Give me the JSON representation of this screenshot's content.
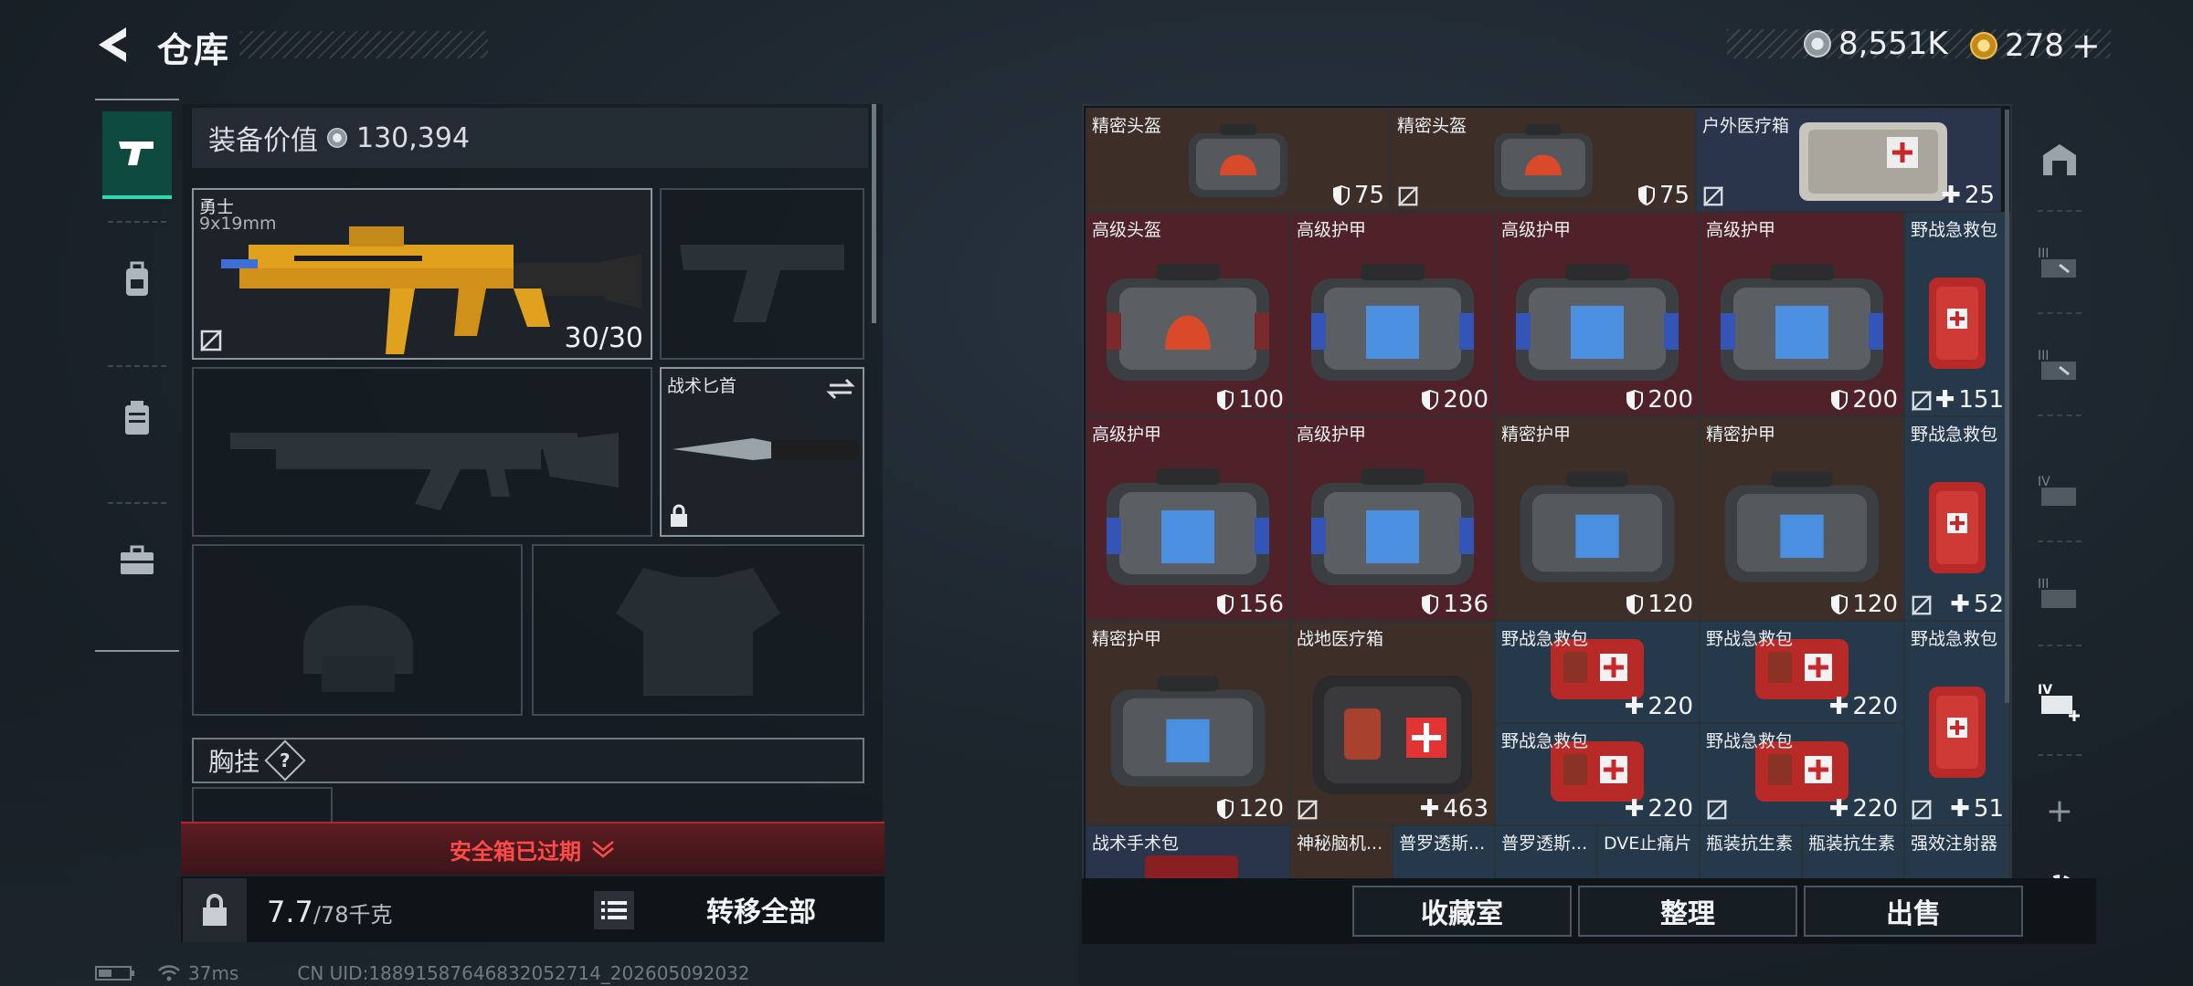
{
  "header": {
    "title": "仓库",
    "currency1": "8,551K",
    "currency2": "278"
  },
  "equipment": {
    "value_label": "装备价值",
    "value": "130,394",
    "primary": {
      "name": "勇士",
      "caliber": "9x19mm",
      "ammo": "30/30"
    },
    "melee": {
      "name": "战术匕首"
    },
    "chest_rig_label": "胸挂",
    "chest_rig_hint": "?",
    "expired_label": "安全箱已过期",
    "weight": "7.7",
    "weight_max": "/78千克",
    "move_all": "转移全部"
  },
  "storage": {
    "row1": [
      {
        "label": "精密头盔",
        "value": "75",
        "kind": "shield"
      },
      {
        "label": "精密头盔",
        "value": "75",
        "kind": "shield"
      },
      {
        "label": "户外医疗箱",
        "value": "25",
        "kind": "plus"
      }
    ],
    "row2": [
      {
        "label": "高级头盔",
        "value": "100"
      },
      {
        "label": "高级护甲",
        "value": "200"
      },
      {
        "label": "高级护甲",
        "value": "200"
      },
      {
        "label": "高级护甲",
        "value": "200"
      },
      {
        "label": "野战急救包",
        "value": "151"
      }
    ],
    "row3": [
      {
        "label": "高级护甲",
        "value": "156"
      },
      {
        "label": "高级护甲",
        "value": "136"
      },
      {
        "label": "精密护甲",
        "value": "120"
      },
      {
        "label": "精密护甲",
        "value": "120"
      },
      {
        "label": "野战急救包",
        "value": "52"
      }
    ],
    "row4": {
      "armor": {
        "label": "精密护甲",
        "value": "120"
      },
      "medbox": {
        "label": "战地医疗箱",
        "value": "463"
      },
      "kits": [
        {
          "label": "野战急救包",
          "value": "220"
        },
        {
          "label": "野战急救包",
          "value": "220"
        },
        {
          "label": "野战急救包",
          "value": "220"
        },
        {
          "label": "野战急救包",
          "value": "220"
        }
      ],
      "kit_tall": {
        "label": "野战急救包",
        "value": "51"
      }
    },
    "row5": [
      "战术手术包",
      "神秘脑机...",
      "普罗透斯...",
      "普罗透斯...",
      "DVE止痛片",
      "瓶装抗生素",
      "瓶装抗生素",
      "强效注射器"
    ]
  },
  "actions": {
    "collection": "收藏室",
    "organize": "整理",
    "sell": "出售"
  },
  "status": {
    "ping": "37ms",
    "uid": "CN UID:18891587646832052714_202605092032"
  },
  "colors": {
    "cell_brown": "#3d2f28",
    "cell_red": "#4f2128",
    "cell_blue": "#26394b",
    "alert": "#ff4a4a",
    "accent": "#2fd9b0"
  }
}
